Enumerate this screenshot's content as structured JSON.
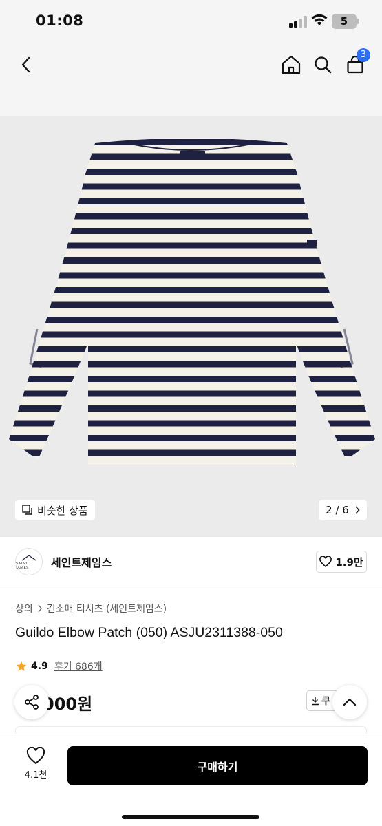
{
  "status_bar": {
    "time": "01:08",
    "battery": "5"
  },
  "header": {
    "cart_count": "3"
  },
  "gallery": {
    "similar_label": "비슷한 상품",
    "page_indicator": "2 / 6"
  },
  "brand": {
    "name": "세인트제임스",
    "logo_text": "SAINT JAMES",
    "like_count": "1.9만"
  },
  "breadcrumb": {
    "category": "상의",
    "subcategory": "긴소매 티셔츠 (세인트제임스)"
  },
  "product": {
    "title": "Guildo Elbow Patch (050) ASJU2311388-050",
    "rating": "4.9",
    "reviews": "후기 686개",
    "price_visible": "000원",
    "coupon_label": "쿠"
  },
  "bottom_bar": {
    "wish_count": "4.1천",
    "buy_label": "구매하기"
  },
  "colors": {
    "accent_badge": "#2b6ef5",
    "star": "#f5a623",
    "stripe_navy": "#1f2140",
    "stripe_cream": "#f4f1e8"
  },
  "icons": [
    "back-icon",
    "home-icon",
    "search-icon",
    "cart-icon",
    "similar-icon",
    "chevron-right-icon",
    "heart-icon",
    "star-icon",
    "share-icon",
    "chevron-up-icon",
    "download-icon"
  ]
}
